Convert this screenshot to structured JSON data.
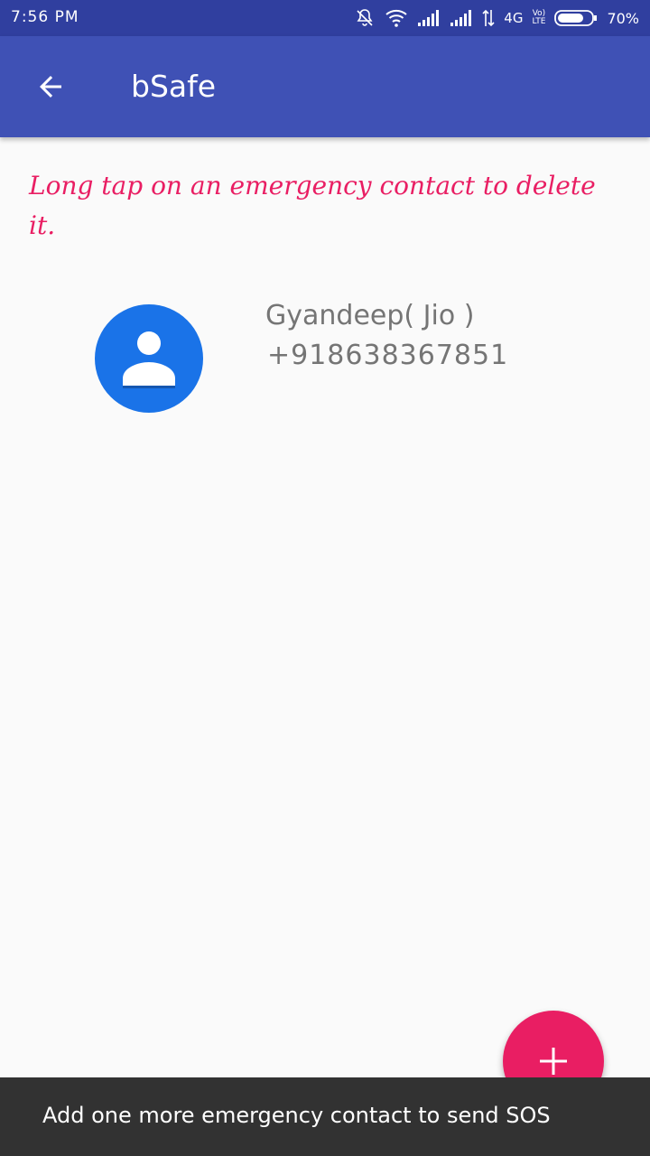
{
  "status_bar": {
    "time": "7:56 PM",
    "network": "4G",
    "volte_top": "Vo)",
    "volte_bottom": "LTE",
    "battery": "70%",
    "icons": [
      "mute-icon",
      "wifi-icon",
      "signal-icon",
      "signal-icon",
      "data-arrows-icon",
      "volte-icon",
      "battery-icon"
    ]
  },
  "app_bar": {
    "title": "bSafe",
    "back_icon": "arrow-back-icon"
  },
  "hint": "Long tap on an emergency contact to delete it.",
  "contacts": [
    {
      "name": "Gyandeep( Jio )",
      "phone": "+918638367851",
      "avatar_icon": "person-icon"
    }
  ],
  "fab": {
    "icon": "plus-icon"
  },
  "snackbar": {
    "message": "Add one more emergency contact to send SOS"
  },
  "colors": {
    "status_bar": "#303f9f",
    "app_bar": "#3f51b5",
    "accent": "#e91e63",
    "avatar": "#1a73e8",
    "snackbar": "#323232"
  }
}
